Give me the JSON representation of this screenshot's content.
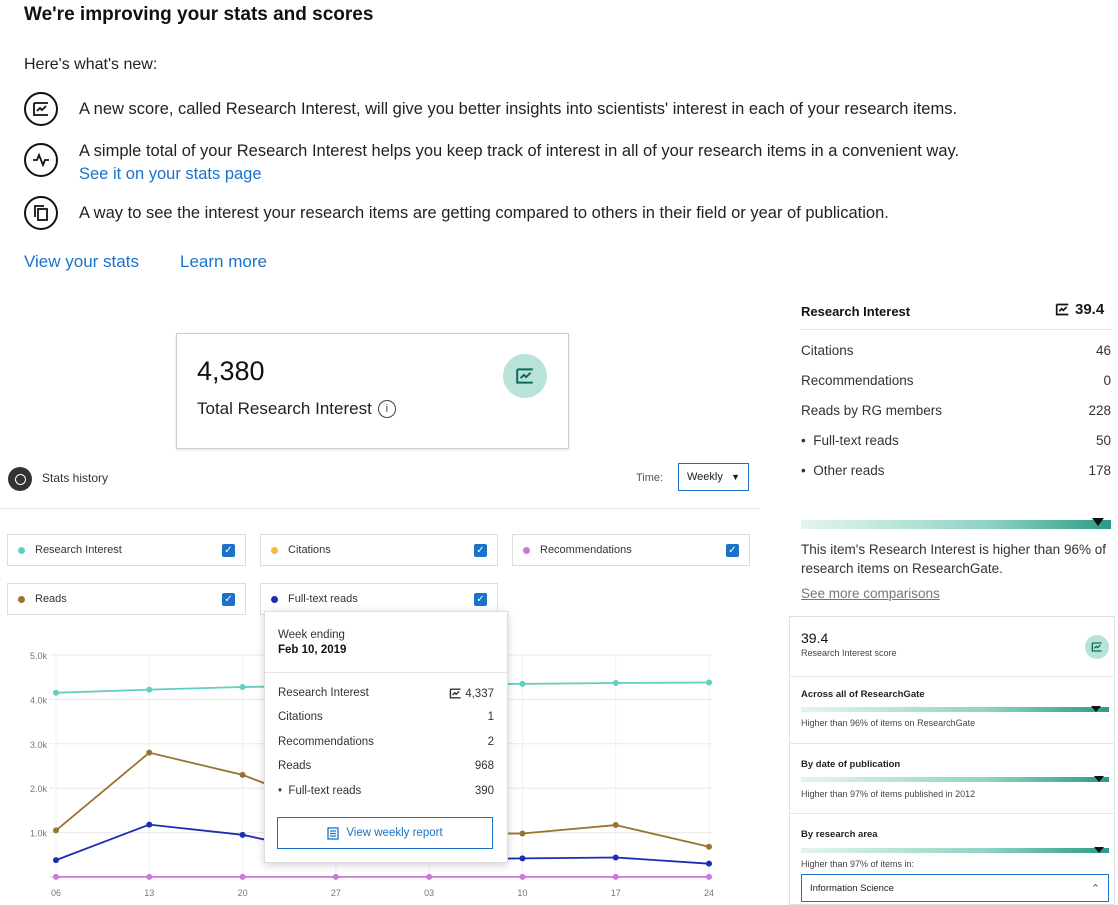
{
  "header": {
    "title": "We're improving your stats and scores",
    "intro": "Here's what's new:"
  },
  "features": [
    {
      "icon": "research-interest-icon",
      "text": "A new score, called Research Interest, will give you better insights into scientists' interest in each of your research items."
    },
    {
      "icon": "pulse-icon",
      "text": "A simple total of your Research Interest helps you keep track of interest in all of your research items in a convenient way.",
      "link": "See it on your stats page"
    },
    {
      "icon": "copy-icon",
      "text": "A way to see the interest your research items are getting compared to others in their field or year of publication."
    }
  ],
  "links": {
    "view_stats": "View your stats",
    "learn_more": "Learn more"
  },
  "total_card": {
    "value": "4,380",
    "label": "Total Research Interest",
    "info": "i"
  },
  "stats_history": {
    "title": "Stats history",
    "time_label": "Time:",
    "time_value": "Weekly",
    "legend": [
      {
        "label": "Research Interest",
        "color": "#5fcfc0",
        "checked": true
      },
      {
        "label": "Citations",
        "color": "#f2b94a",
        "checked": true
      },
      {
        "label": "Recommendations",
        "color": "#c879d6",
        "checked": true
      },
      {
        "label": "Reads",
        "color": "#9a7330",
        "checked": true
      },
      {
        "label": "Full-text reads",
        "color": "#1c2db5",
        "checked": true
      }
    ]
  },
  "chart_data": {
    "type": "line",
    "x": [
      "06",
      "13",
      "20",
      "27",
      "03",
      "10",
      "17",
      "24"
    ],
    "ylim": [
      0,
      5000
    ],
    "yticks": [
      "5.0k",
      "4.0k",
      "3.0k",
      "2.0k",
      "1.0k"
    ],
    "series": [
      {
        "name": "Research Interest",
        "color": "#5fcfc0",
        "values": [
          4150,
          4220,
          4280,
          4310,
          4337,
          4350,
          4370,
          4380
        ]
      },
      {
        "name": "Reads",
        "color": "#9a7330",
        "values": [
          1050,
          2800,
          2300,
          1500,
          968,
          980,
          1170,
          680
        ]
      },
      {
        "name": "Full-text reads",
        "color": "#1c2db5",
        "values": [
          380,
          1180,
          950,
          500,
          390,
          420,
          440,
          300
        ]
      },
      {
        "name": "Recommendations",
        "color": "#c879d6",
        "values": [
          2,
          2,
          2,
          2,
          2,
          2,
          2,
          2
        ]
      }
    ]
  },
  "tooltip": {
    "heading": "Week ending",
    "date": "Feb 10, 2019",
    "rows": [
      {
        "label": "Research Interest",
        "value": "4,337"
      },
      {
        "label": "Citations",
        "value": "1"
      },
      {
        "label": "Recommendations",
        "value": "2"
      },
      {
        "label": "Reads",
        "value": "968"
      },
      {
        "label": "Full-text reads",
        "value": "390"
      }
    ],
    "button": "View weekly report"
  },
  "research_panel": {
    "title": "Research Interest",
    "score": "39.4",
    "rows": [
      {
        "label": "Citations",
        "value": "46"
      },
      {
        "label": "Recommendations",
        "value": "0"
      },
      {
        "label": "Reads by RG members",
        "value": "228"
      },
      {
        "label": "Full-text reads",
        "value": "50"
      },
      {
        "label": "Other reads",
        "value": "178"
      }
    ],
    "percentile": 0.96,
    "comparison_text": "This item's Research Interest is higher than 96% of research items on ResearchGate.",
    "see_more": "See more comparisons"
  },
  "score_panel": {
    "score": "39.4",
    "score_label": "Research Interest score",
    "sections": [
      {
        "title": "Across all of ResearchGate",
        "text": "Higher than 96% of items on ResearchGate",
        "percentile": 0.96
      },
      {
        "title": "By date of publication",
        "text": "Higher than 97% of items published in 2012",
        "percentile": 0.97
      },
      {
        "title": "By research area",
        "text": "Higher than 97% of items in:",
        "percentile": 0.97
      }
    ],
    "area_select": "Information Science"
  }
}
